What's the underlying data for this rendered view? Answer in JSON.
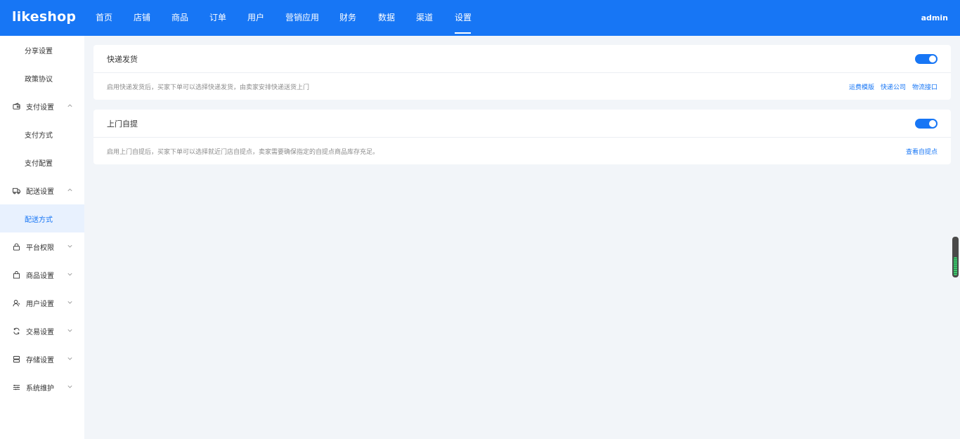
{
  "header": {
    "logo": "likeshop",
    "nav": [
      "首页",
      "店铺",
      "商品",
      "订单",
      "用户",
      "营销应用",
      "财务",
      "数据",
      "渠道",
      "设置"
    ],
    "active_nav": "设置",
    "user": "admin"
  },
  "sidebar": {
    "items": [
      {
        "label": "分享设置",
        "type": "sub"
      },
      {
        "label": "政策协议",
        "type": "sub"
      },
      {
        "label": "支付设置",
        "type": "group",
        "icon": "wallet-icon",
        "expanded": true
      },
      {
        "label": "支付方式",
        "type": "sub"
      },
      {
        "label": "支付配置",
        "type": "sub"
      },
      {
        "label": "配送设置",
        "type": "group",
        "icon": "truck-icon",
        "expanded": true
      },
      {
        "label": "配送方式",
        "type": "sub",
        "active": true
      },
      {
        "label": "平台权限",
        "type": "group",
        "icon": "lock-icon",
        "expanded": false
      },
      {
        "label": "商品设置",
        "type": "group",
        "icon": "bag-icon",
        "expanded": false
      },
      {
        "label": "用户设置",
        "type": "group",
        "icon": "user-icon",
        "expanded": false
      },
      {
        "label": "交易设置",
        "type": "group",
        "icon": "refresh-icon",
        "expanded": false
      },
      {
        "label": "存储设置",
        "type": "group",
        "icon": "database-icon",
        "expanded": false
      },
      {
        "label": "系统维护",
        "type": "group",
        "icon": "sliders-icon",
        "expanded": false
      }
    ]
  },
  "cards": [
    {
      "title": "快递发货",
      "enabled": true,
      "desc": "启用快递发货后，买家下单可以选择快递发货，由卖家安排快递送货上门",
      "links": [
        "运费模版",
        "快递公司",
        "物流接口"
      ]
    },
    {
      "title": "上门自提",
      "enabled": true,
      "desc": "启用上门自提后，买家下单可以选择就近门店自提点，卖家需要确保指定的自提点商品库存充足。",
      "links": [
        "查看自提点"
      ]
    }
  ],
  "colors": {
    "primary": "#1776f5",
    "background": "#f2f5f9",
    "sidebar_active_bg": "#e8f1fe"
  }
}
